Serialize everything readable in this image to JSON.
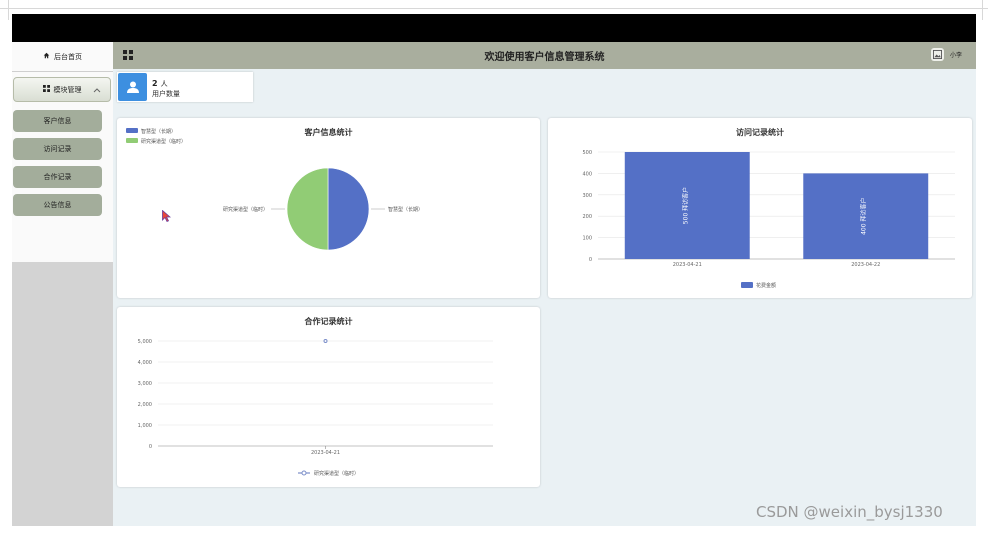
{
  "sidebar": {
    "home_label": "后台首页",
    "menu_label": "模块管理",
    "items": [
      {
        "label": "客户信息"
      },
      {
        "label": "访问记录"
      },
      {
        "label": "合作记录"
      },
      {
        "label": "公告信息"
      }
    ]
  },
  "header": {
    "title": "欢迎使用客户信息管理系统",
    "user": "小李"
  },
  "stat": {
    "count": "2",
    "unit": "人",
    "label": "用户数量"
  },
  "panels": {
    "pie_title": "客户信息统计",
    "bar_title": "访问记录统计",
    "line_title": "合作记录统计"
  },
  "chart_data": [
    {
      "type": "pie",
      "title": "客户信息统计",
      "legend": [
        "智慧型（长期）",
        "研究渠道型（临时）"
      ],
      "legend_position": "top-left",
      "slices": [
        {
          "name": "智慧型（长期）",
          "value": 1,
          "color": "#5470c6"
        },
        {
          "name": "研究渠道型（临时）",
          "value": 1,
          "color": "#91cc75"
        }
      ]
    },
    {
      "type": "bar",
      "title": "访问记录统计",
      "categories": [
        "2023-04-21",
        "2023-04-22"
      ],
      "series": [
        {
          "name": "花费金额",
          "values": [
            500,
            400
          ],
          "color": "#5470c6"
        }
      ],
      "bar_labels": [
        "500 拜访客户",
        "400 拜访客户"
      ],
      "yticks": [
        "0",
        "100",
        "200",
        "300",
        "400",
        "500"
      ],
      "ylim": [
        0,
        500
      ],
      "legend_position": "bottom-center"
    },
    {
      "type": "line",
      "title": "合作记录统计",
      "categories": [
        "2023-04-21"
      ],
      "series": [
        {
          "name": "研究渠道型（临时）",
          "values": [
            5000
          ],
          "color": "#7b8ec9"
        }
      ],
      "yticks": [
        "0",
        "1,000",
        "2,000",
        "3,000",
        "4,000",
        "5,000"
      ],
      "ylim": [
        0,
        5000
      ],
      "legend_position": "bottom-center"
    }
  ],
  "watermark": "CSDN @weixin_bysj1330"
}
